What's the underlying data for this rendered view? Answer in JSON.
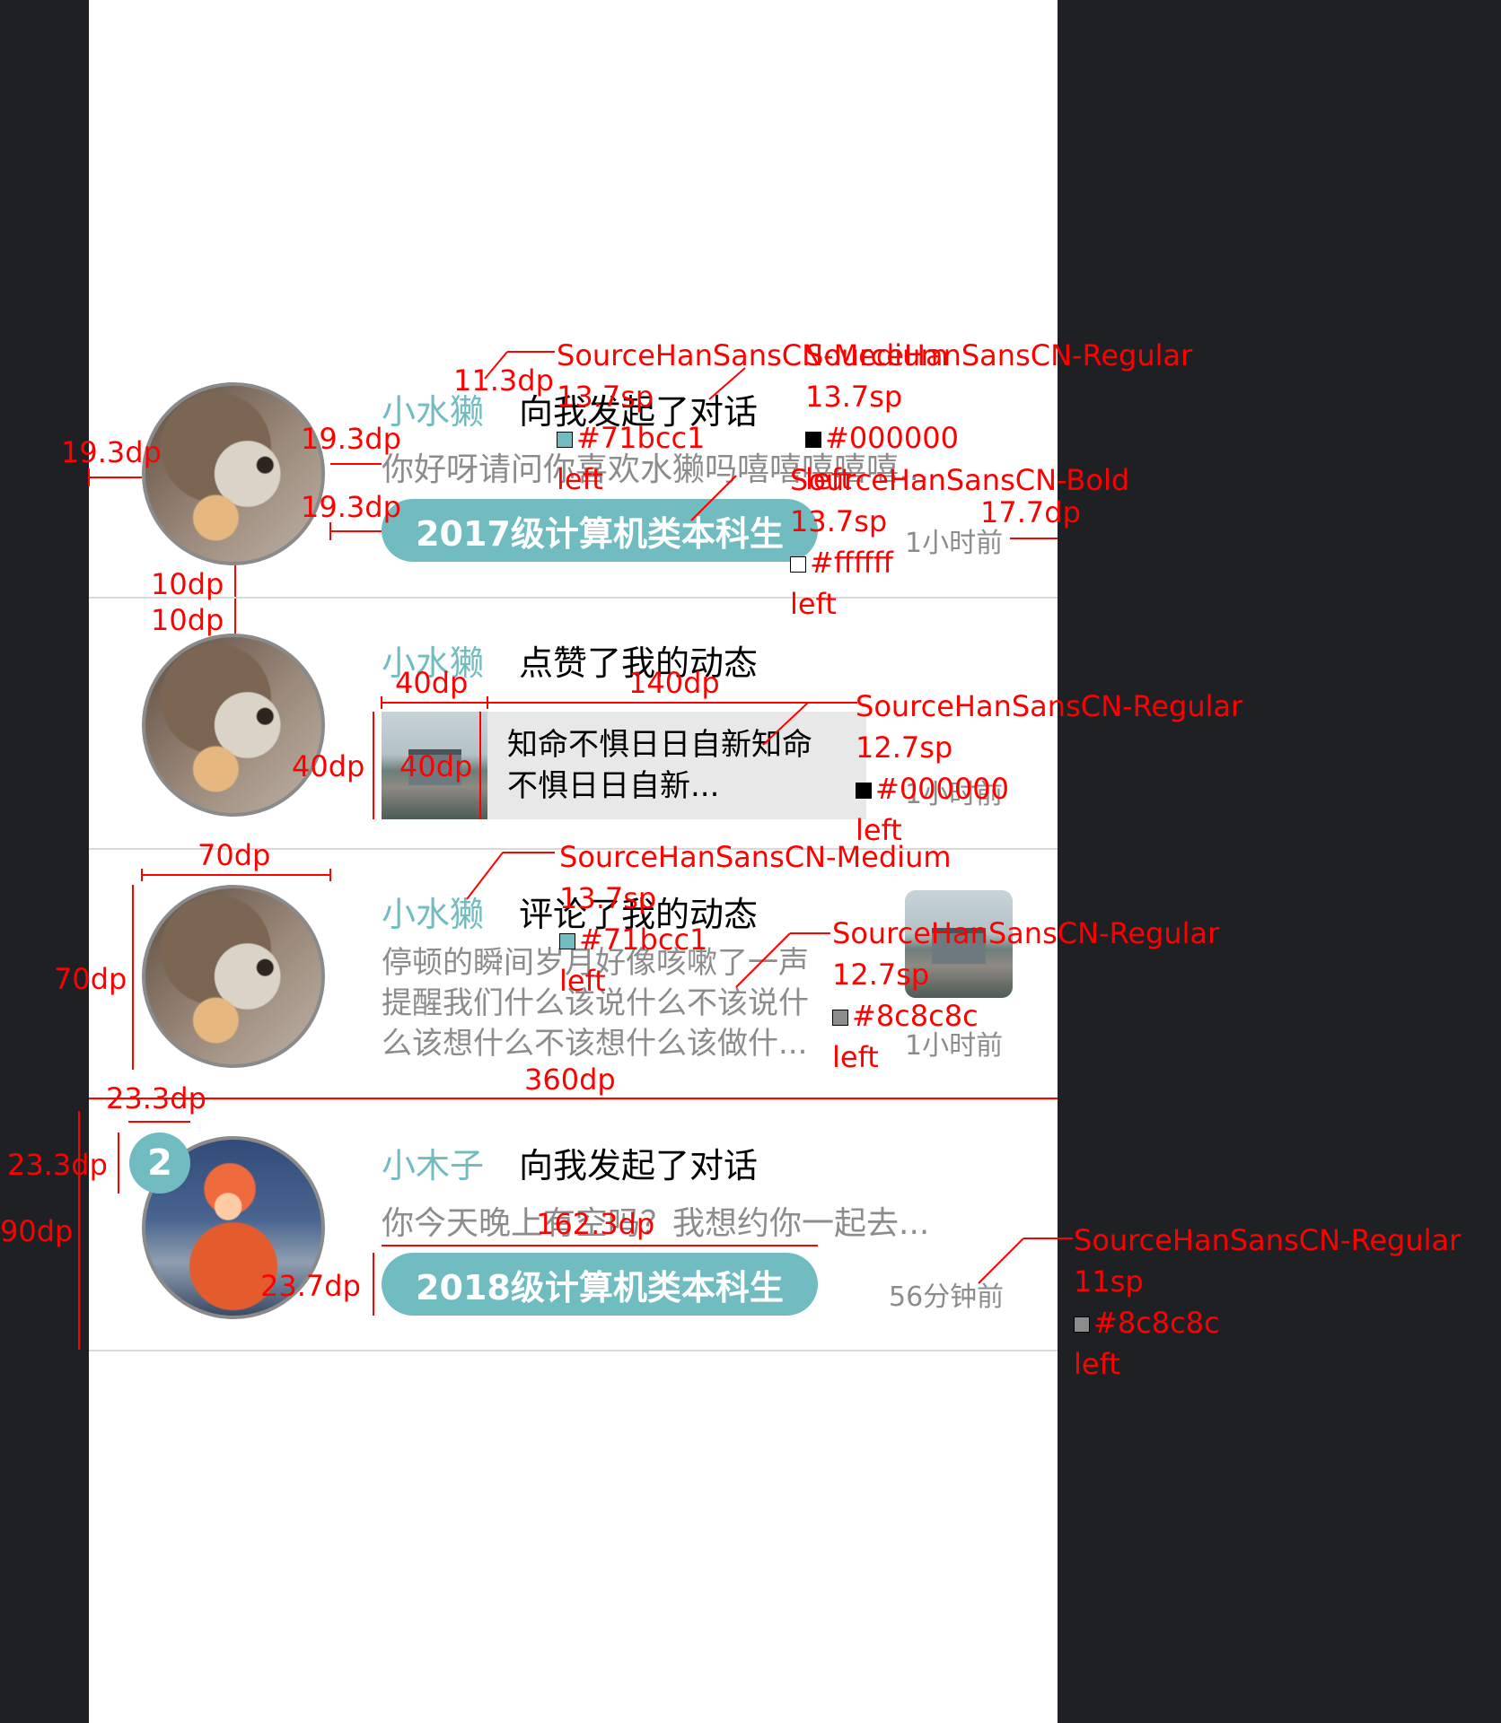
{
  "colors": {
    "accent": "#71bcc1",
    "text": "#000000",
    "muted": "#8c8c8c",
    "white": "#ffffff",
    "annotation": "#ff0000",
    "background": "#1f2024"
  },
  "items": [
    {
      "username": "小水獭",
      "action": "向我发起了对话",
      "preview": "你好呀请问你喜欢水獭吗嘻嘻嘻嘻嘻...",
      "tag": "2017级计算机类本科生",
      "time": "1小时前",
      "avatar": "otter-avatar"
    },
    {
      "username": "小水獭",
      "action": "点赞了我的动态",
      "card_text_line1": "知命不惧日日自新知命",
      "card_text_line2": "不惧日日自新...",
      "time": "1小时前",
      "avatar": "otter-avatar"
    },
    {
      "username": "小水獭",
      "action": "评论了我的动态",
      "preview_lines": [
        "停顿的瞬间岁月好像咳嗽了一声",
        "提醒我们什么该说什么不该说什",
        "么该想什么不该想什么该做什..."
      ],
      "time": "1小时前",
      "avatar": "otter-avatar"
    },
    {
      "username": "小木子",
      "action": "向我发起了对话",
      "preview": "你今天晚上有空吗？我想约你一起去...",
      "tag": "2018级计算机类本科生",
      "time": "56分钟前",
      "badge": "2",
      "avatar": "anime-avatar"
    }
  ],
  "annotations": {
    "a1": "11.3dp",
    "a2_font": "SourceHanSansCN-Medium",
    "a2_size": "13.7sp",
    "a2_color": "#71bcc1",
    "a2_align": "left",
    "a3_font": "SourceHanSansCN-Regular",
    "a3_size": "13.7sp",
    "a3_color": "#000000",
    "a3_align": "left",
    "a4": "19.3dp",
    "a5": "19.3dp",
    "a6": "19.3dp",
    "a7_font": "SourceHanSansCN-Bold",
    "a7_size": "13.7sp",
    "a7_color": "#ffffff",
    "a7_align": "left",
    "a8": "17.7dp",
    "a9": "10dp",
    "a10": "10dp",
    "a11": "40dp",
    "a12": "140dp",
    "a13": "40dp",
    "a14": "40dp",
    "a15_font": "SourceHanSansCN-Regular",
    "a15_size": "12.7sp",
    "a15_color": "#000000",
    "a15_align": "left",
    "a16": "70dp",
    "a17": "70dp",
    "a18_font": "SourceHanSansCN-Medium",
    "a18_size": "13.7sp",
    "a18_color": "#71bcc1",
    "a18_align": "left",
    "a19_font": "SourceHanSansCN-Regular",
    "a19_size": "12.7sp",
    "a19_color": "#8c8c8c",
    "a19_align": "left",
    "a20": "360dp",
    "a21": "23.3dp",
    "a22": "23.3dp",
    "a23": "90dp",
    "a24": "162.3dp",
    "a25": "23.7dp",
    "a26_font": "SourceHanSansCN-Regular",
    "a26_size": "11sp",
    "a26_color": "#8c8c8c",
    "a26_align": "left"
  }
}
